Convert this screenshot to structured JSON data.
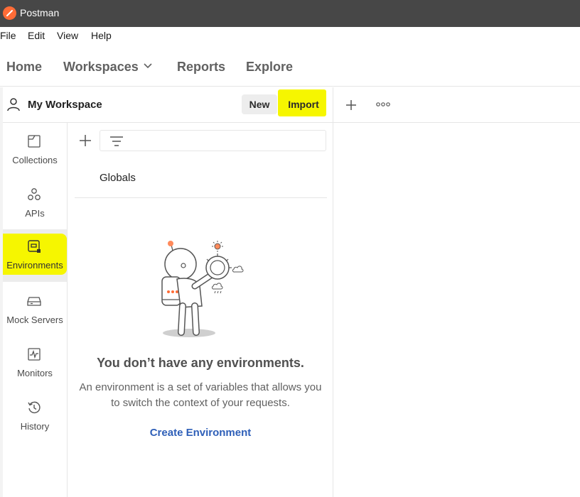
{
  "window": {
    "title": "Postman"
  },
  "menu": [
    "File",
    "Edit",
    "View",
    "Help"
  ],
  "nav": {
    "home": "Home",
    "workspaces": "Workspaces",
    "reports": "Reports",
    "explore": "Explore"
  },
  "workspace": {
    "name": "My Workspace",
    "new_label": "New",
    "import_label": "Import"
  },
  "sidebar": {
    "items": [
      {
        "label": "Collections",
        "icon": "collections-icon"
      },
      {
        "label": "APIs",
        "icon": "apis-icon"
      },
      {
        "label": "Environments",
        "icon": "environments-icon",
        "active": true
      },
      {
        "label": "Mock Servers",
        "icon": "mock-servers-icon"
      },
      {
        "label": "Monitors",
        "icon": "monitors-icon"
      },
      {
        "label": "History",
        "icon": "history-icon"
      }
    ]
  },
  "panel": {
    "globals": "Globals",
    "empty_title": "You don’t have any environments.",
    "empty_desc": "An environment is a set of variables that allows you to switch the context of your requests.",
    "create_label": "Create Environment"
  },
  "colors": {
    "highlight": "#f6f600",
    "accent": "#ff6c37",
    "link": "#2e5fb8"
  }
}
